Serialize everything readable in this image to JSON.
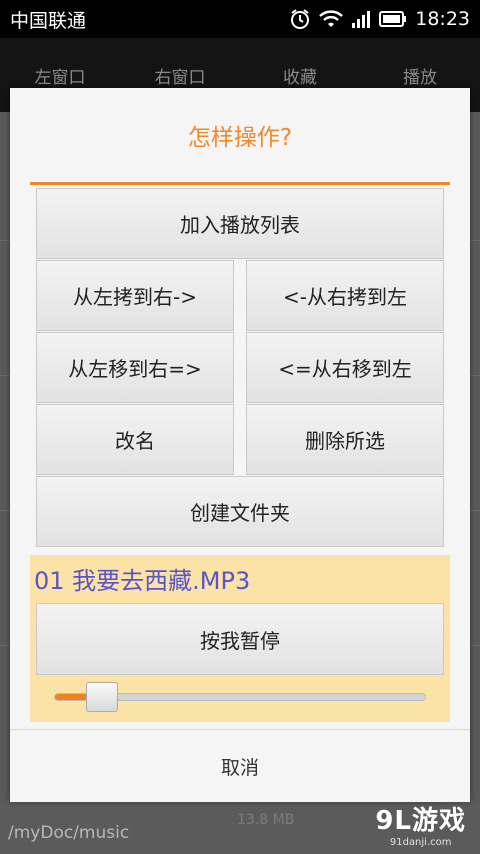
{
  "status": {
    "carrier": "中国联通",
    "time": "18:23"
  },
  "tabs": [
    "左窗口",
    "右窗口",
    "收藏",
    "播放"
  ],
  "background": {
    "path": "/myDoc/music",
    "size_partial": "13.8 MB"
  },
  "dialog": {
    "title": "怎样操作?",
    "buttons": {
      "add_playlist": "加入播放列表",
      "copy_left_to_right": "从左拷到右->",
      "copy_right_to_left": "<-从右拷到左",
      "move_left_to_right": "从左移到右=>",
      "move_right_to_left": "<=从右移到左",
      "rename": "改名",
      "delete_selected": "删除所选",
      "create_folder": "创建文件夹"
    },
    "player": {
      "track": "01 我要去西藏.MP3",
      "pause_label": "按我暂停",
      "progress": 0.16
    },
    "cancel": "取消"
  },
  "watermark": {
    "main": "9L游戏",
    "sub": "91danji.com"
  },
  "colors": {
    "accent": "#ef8a2b",
    "track_text": "#5a54c7",
    "player_bg": "#fbe3a8"
  }
}
